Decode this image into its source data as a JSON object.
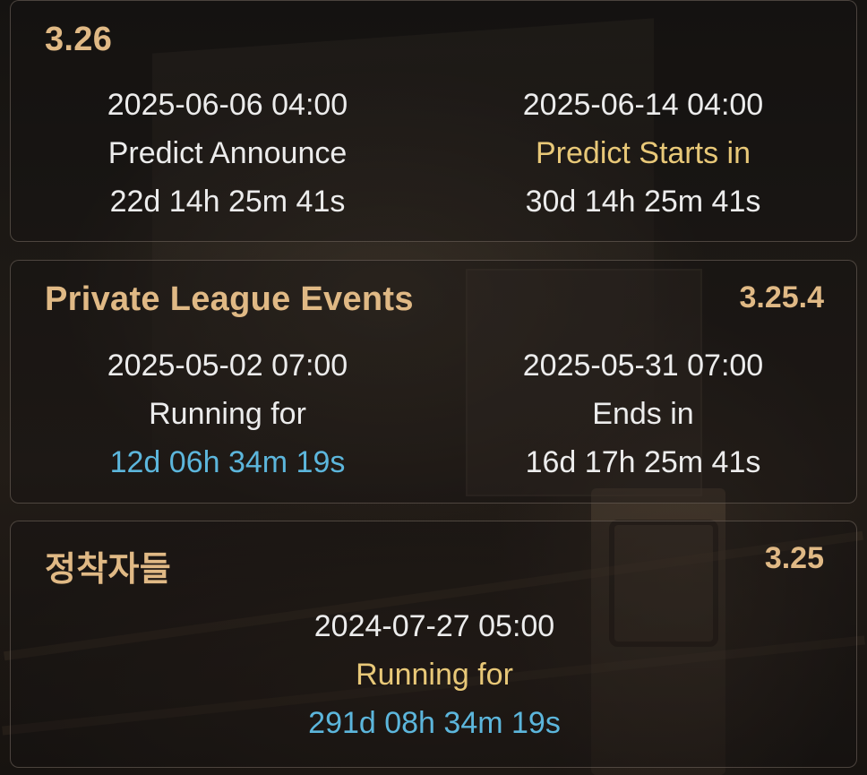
{
  "events": [
    {
      "title": "3.26",
      "version": "",
      "left": {
        "date": "2025-06-06 04:00",
        "label": "Predict Announce",
        "timer": "22d 14h 25m 41s"
      },
      "right": {
        "date": "2025-06-14 04:00",
        "label": "Predict Starts in",
        "timer": "30d 14h 25m 41s"
      }
    },
    {
      "title": "Private League Events",
      "version": "3.25.4",
      "left": {
        "date": "2025-05-02 07:00",
        "label": "Running for",
        "timer": "12d 06h 34m 19s"
      },
      "right": {
        "date": "2025-05-31 07:00",
        "label": "Ends in",
        "timer": "16d 17h 25m 41s"
      }
    },
    {
      "title": "정착자들",
      "version": "3.25",
      "center": {
        "date": "2024-07-27 05:00",
        "label": "Running for",
        "timer": "291d 08h 34m 19s"
      }
    }
  ],
  "colors": {
    "title": "#e0b985",
    "label_highlight": "#e8c878",
    "timer_running": "#5cb6dc",
    "text": "#ececec"
  }
}
